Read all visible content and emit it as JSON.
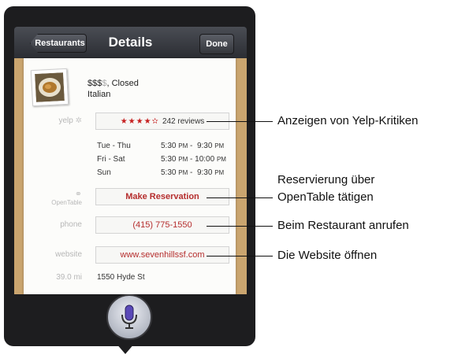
{
  "nav": {
    "back_label": "Restaurants",
    "title": "Details",
    "done_label": "Done"
  },
  "restaurant": {
    "price_active": "$$$",
    "price_inactive": "$",
    "status": ", Closed",
    "cuisine": "Italian",
    "rating_stars": "★★★★✫",
    "reviews": "242 reviews",
    "hours": [
      {
        "day": "Tue - Thu",
        "open": "5:30",
        "close": "9:30"
      },
      {
        "day": "Fri - Sat",
        "open": "5:30",
        "close": "10:00"
      },
      {
        "day": "Sun",
        "open": "5:30",
        "close": "9:30"
      }
    ],
    "am_pm": "PM",
    "separator": "-",
    "reservation": "Make Reservation",
    "phone_label": "phone",
    "phone": "(415) 775-1550",
    "website_label": "website",
    "website": "www.sevenhillssf.com",
    "distance": "39.0 mi",
    "address": "1550 Hyde St"
  },
  "labels": {
    "yelp": "yelp",
    "opentable": "OpenTable"
  },
  "callouts": {
    "yelp": "Anzeigen von Yelp-Kritiken",
    "reserve_line1": "Reservierung über",
    "reserve_line2": "OpenTable tätigen",
    "call": "Beim Restaurant anrufen",
    "web": "Die Website öffnen"
  }
}
